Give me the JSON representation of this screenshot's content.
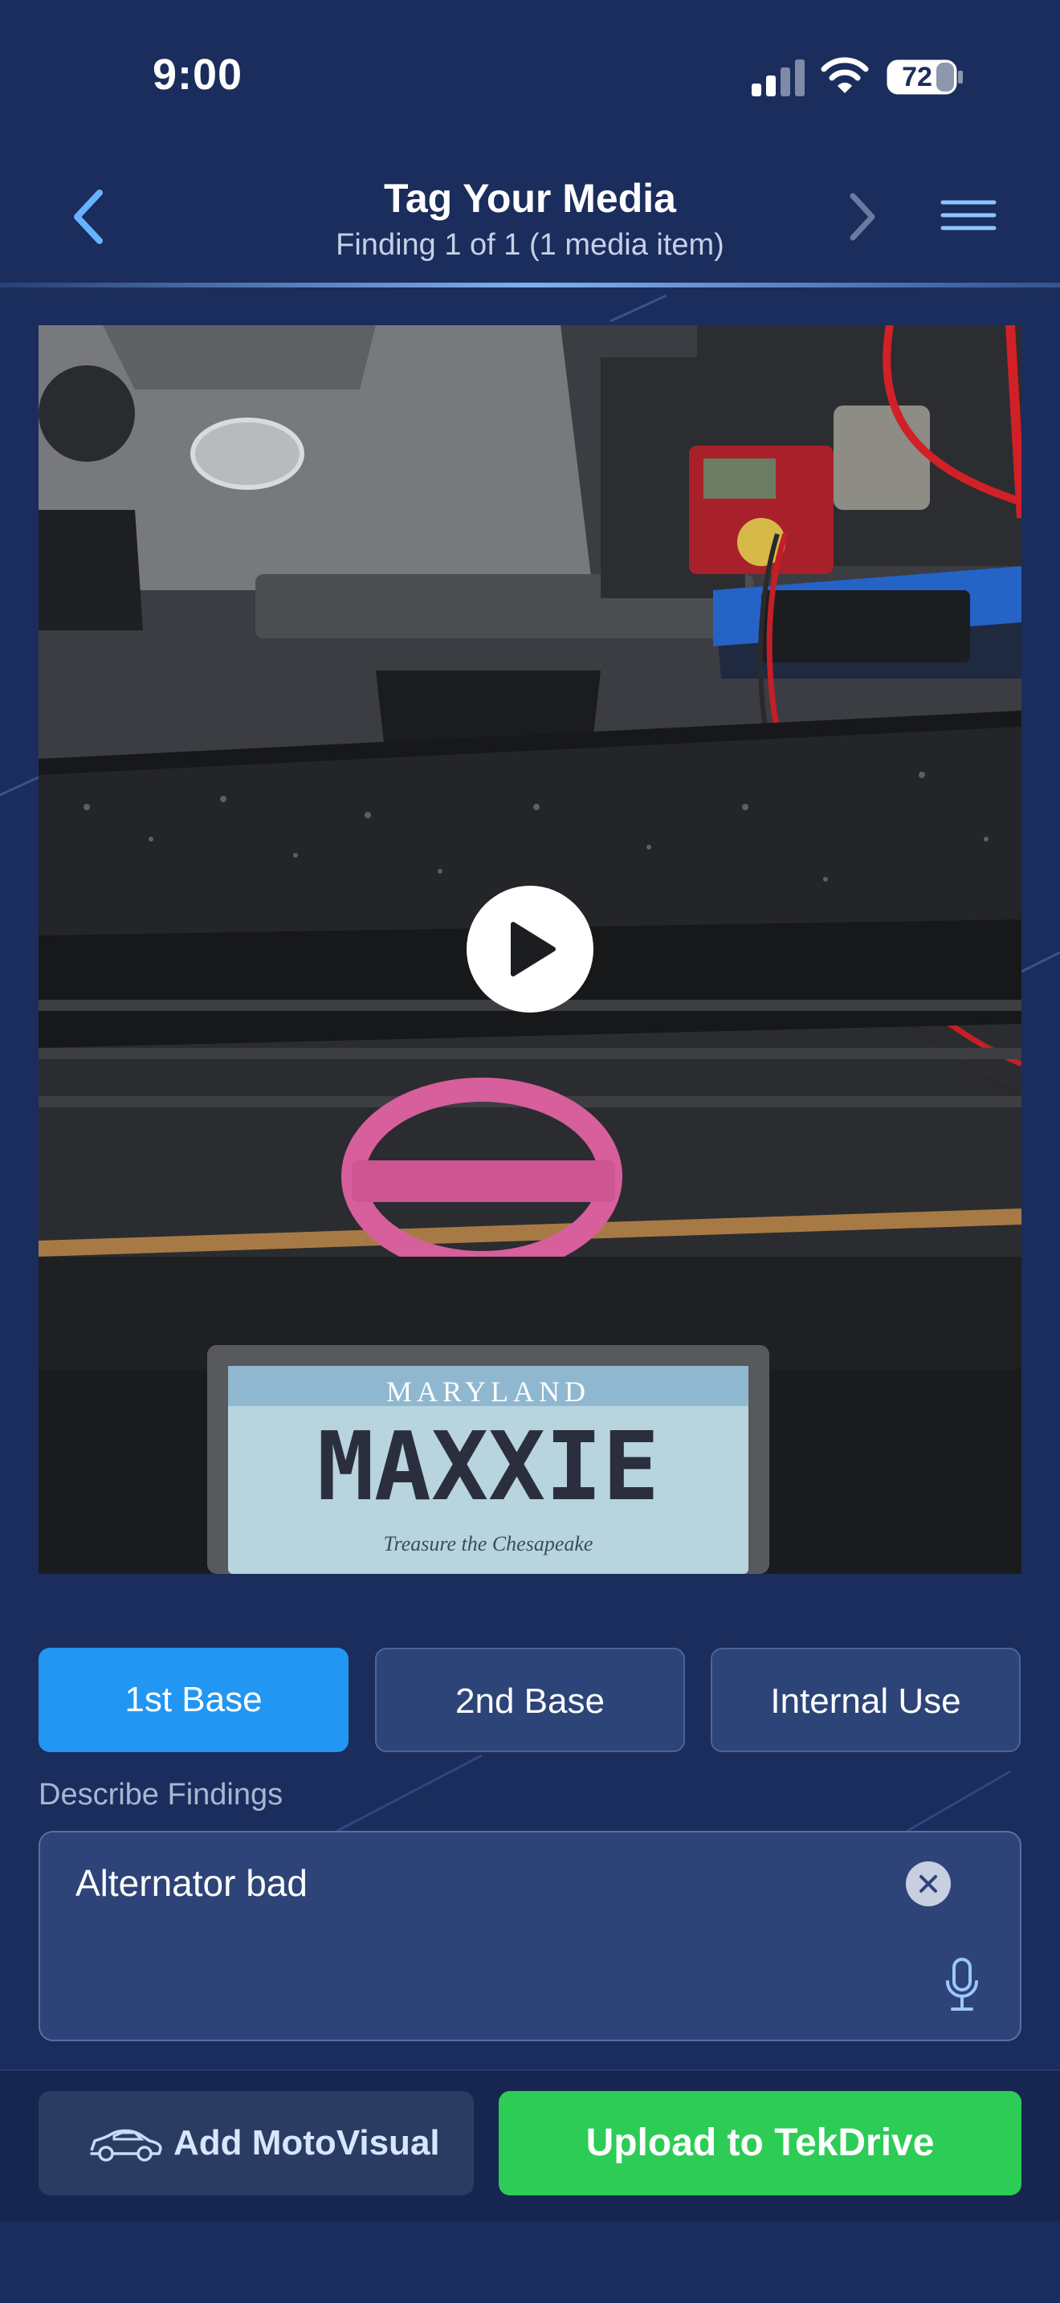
{
  "status_bar": {
    "time": "9:00",
    "battery": "72",
    "icons": [
      "signal-icon",
      "wifi-icon",
      "battery-icon"
    ]
  },
  "header": {
    "title": "Tag Your Media",
    "subtitle": "Finding 1 of 1 (1 media item)",
    "icons": [
      "chevron-left-icon",
      "chevron-right-icon",
      "menu-icon"
    ]
  },
  "media": {
    "plate_state": "MARYLAND",
    "plate_number": "MAXXIE",
    "plate_tagline": "Treasure the Chesapeake",
    "play_icon": "play-icon"
  },
  "tabs": [
    {
      "label": "1st Base",
      "active": true
    },
    {
      "label": "2nd Base",
      "active": false
    },
    {
      "label": "Internal Use",
      "active": false
    }
  ],
  "findings": {
    "label": "Describe Findings",
    "value": "Alternator bad",
    "icons": [
      "clear-icon",
      "microphone-icon"
    ]
  },
  "actions": {
    "moto_label": "Add MotoVisual",
    "moto_icon": "car-icon",
    "upload_label": "Upload to TekDrive"
  },
  "colors": {
    "background": "#1b2d5c",
    "active_tab": "#2196f3",
    "upload": "#2dcc56"
  }
}
